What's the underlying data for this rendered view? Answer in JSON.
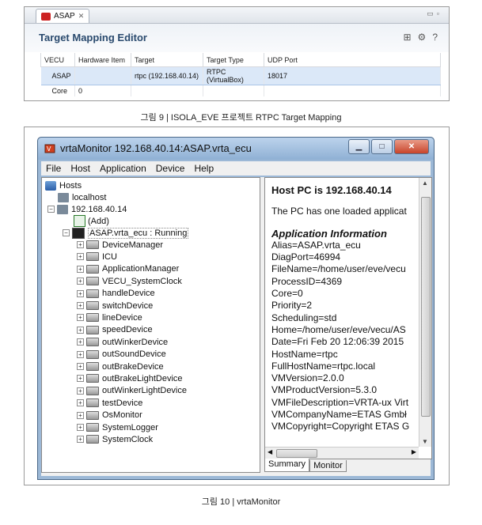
{
  "fig9": {
    "tab_label": "ASAP",
    "editor_title": "Target Mapping Editor",
    "columns": [
      "VECU",
      "Hardware Item",
      "Target",
      "Target Type",
      "UDP Port"
    ],
    "rows": [
      [
        "ASAP",
        "",
        "rtpc (192.168.40.14)",
        "RTPC (VirtualBox)",
        "18017"
      ],
      [
        "Core",
        "0",
        "",
        "",
        ""
      ]
    ],
    "caption": "그림 9 | ISOLA_EVE 프로젝트 RTPC Target Mapping"
  },
  "fig10": {
    "window_title": "vrtaMonitor 192.168.40.14:ASAP.vrta_ecu",
    "menu": [
      "File",
      "Host",
      "Application",
      "Device",
      "Help"
    ],
    "tree": {
      "root": "Hosts",
      "localhost": "localhost",
      "host_ip": "192.168.40.14",
      "add": "(Add)",
      "app": "ASAP.vrta_ecu : Running",
      "devices": [
        "DeviceManager",
        "ICU",
        "ApplicationManager",
        "VECU_SystemClock",
        "handleDevice",
        "switchDevice",
        "lineDevice",
        "speedDevice",
        "outWinkerDevice",
        "outSoundDevice",
        "outBrakeDevice",
        "outBrakeLightDevice",
        "outWinkerLightDevice",
        "testDevice",
        "OsMonitor",
        "SystemLogger",
        "SystemClock"
      ]
    },
    "info": {
      "heading": "Host PC is 192.168.40.14",
      "loaded": "The PC has one loaded applicat",
      "section": "Application Information",
      "lines": [
        "Alias=ASAP.vrta_ecu",
        "DiagPort=46994",
        "FileName=/home/user/eve/vecu",
        "ProcessID=4369",
        "Core=0",
        "Priority=2",
        "Scheduling=std",
        "Home=/home/user/eve/vecu/AS",
        "Date=Fri Feb 20 12:06:39 2015",
        "HostName=rtpc",
        "FullHostName=rtpc.local",
        "VMVersion=2.0.0",
        "VMProductVersion=5.3.0",
        "VMFileDescription=VRTA-ux Virt",
        "VMCompanyName=ETAS Gmbł",
        "VMCopyright=Copyright ETAS G"
      ]
    },
    "tabs": [
      "Summary",
      "Monitor"
    ],
    "caption": "그림 10 | vrtaMonitor"
  }
}
